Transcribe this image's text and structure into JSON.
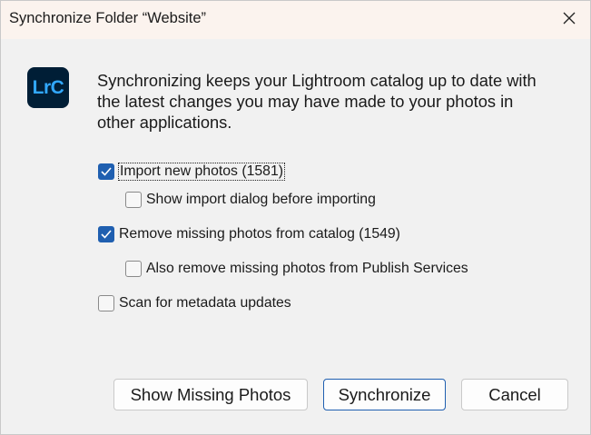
{
  "window": {
    "title": "Synchronize Folder “Website”"
  },
  "logo": {
    "text": "LrC",
    "background": "#001e36",
    "foreground": "#31a8ff"
  },
  "description": "Synchronizing keeps your Lightroom catalog up to date with the latest changes you may have made to your photos in other applications.",
  "options": [
    {
      "label": "Import new photos (1581)",
      "checked": true
    },
    {
      "label": "Show import dialog before importing",
      "checked": false
    },
    {
      "label": "Remove missing photos from catalog (1549)",
      "checked": true
    },
    {
      "label": "Also remove missing photos from Publish Services",
      "checked": false
    },
    {
      "label": "Scan for metadata updates",
      "checked": false
    }
  ],
  "buttons": {
    "show_missing": "Show Missing Photos",
    "synchronize": "Synchronize",
    "cancel": "Cancel"
  },
  "colors": {
    "accent": "#1f5fb0",
    "titlebar": "#fbf3ee",
    "body": "#f1f1f1"
  }
}
